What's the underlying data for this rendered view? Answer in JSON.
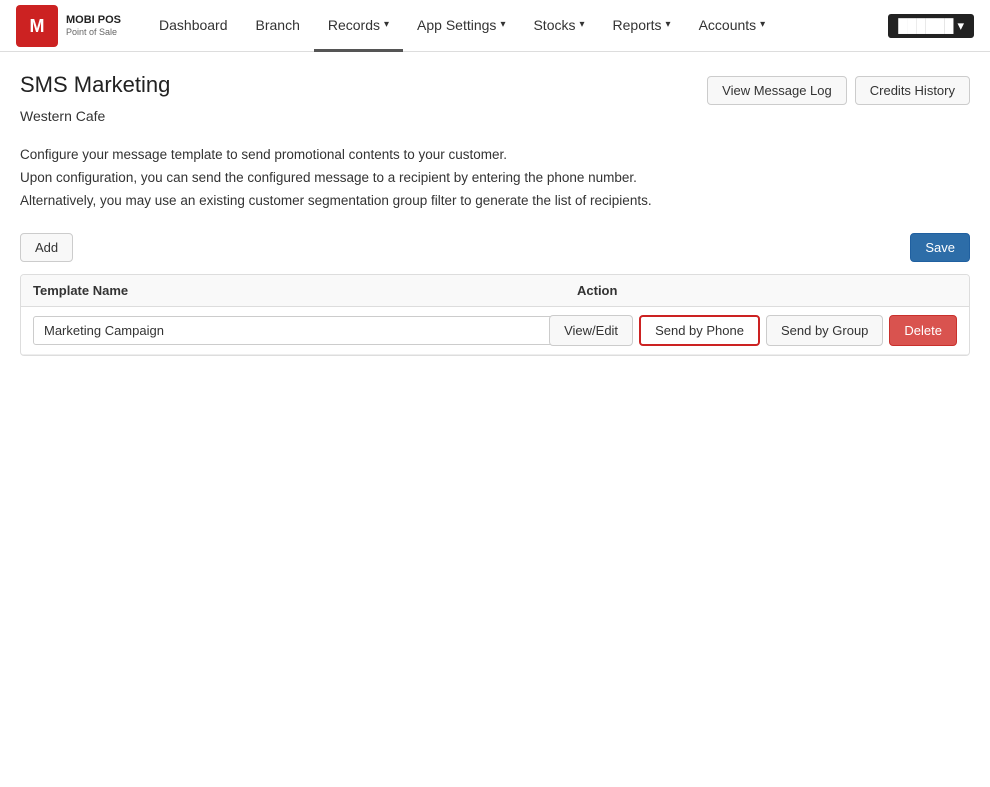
{
  "brand": {
    "letter": "M",
    "name_top": "MOBI POS",
    "name_bottom": "Point of Sale"
  },
  "nav": {
    "items": [
      {
        "label": "Dashboard",
        "active": false,
        "has_caret": false
      },
      {
        "label": "Branch",
        "active": false,
        "has_caret": false
      },
      {
        "label": "Records",
        "active": true,
        "has_caret": true
      },
      {
        "label": "App Settings",
        "active": false,
        "has_caret": true
      },
      {
        "label": "Stocks",
        "active": false,
        "has_caret": true
      },
      {
        "label": "Reports",
        "active": false,
        "has_caret": true
      },
      {
        "label": "Accounts",
        "active": false,
        "has_caret": true
      }
    ],
    "user": "██████"
  },
  "page": {
    "title": "SMS Marketing",
    "store": "Western Cafe",
    "view_message_log": "View Message Log",
    "credits_history": "Credits History",
    "description_line1": "Configure your message template to send promotional contents to your customer.",
    "description_line2": "Upon configuration, you can send the configured message to a recipient by entering the phone number.",
    "description_line3": "Alternatively, you may use an existing customer segmentation group filter to generate the list of recipients.",
    "add_button": "Add",
    "save_button": "Save",
    "col_template_name": "Template Name",
    "col_action": "Action"
  },
  "table": {
    "rows": [
      {
        "template_name": "Marketing Campaign",
        "view_edit": "View/Edit",
        "send_by_phone": "Send by Phone",
        "send_by_group": "Send by Group",
        "delete": "Delete"
      }
    ]
  }
}
